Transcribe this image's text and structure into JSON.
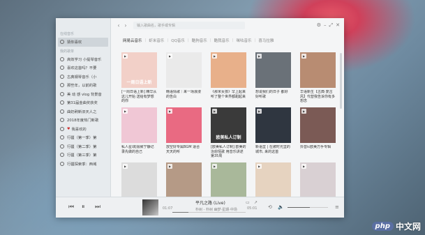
{
  "sidebar": {
    "section_online": "在线音乐",
    "active_item": "猜你喜欢",
    "section_playlists": "我的歌单",
    "items": [
      "高效学习 小提琴音乐",
      "喜欢这首吗？不要",
      "古典钢琴音乐（小",
      "那些年，以前的歌",
      "美 动 感 vlog 背景音",
      "第31届金曲奖获奖",
      "曲奶刷新旧天人之",
      "2018年度热门新歌",
      "我喜欢的",
      "行疆（第一季）第",
      "行疆（第二季）第",
      "行疆（第三季）第",
      "行疆探索季：西域"
    ]
  },
  "topbar": {
    "search_placeholder": "输入歌曲名，歌手或专辑"
  },
  "tabs": [
    "网易云音乐",
    "虾米音乐",
    "QQ音乐",
    "酷狗音乐",
    "酷我音乐",
    "咪咕音乐",
    "喜马拉雅"
  ],
  "cards": [
    {
      "caption": "[一周日语上新] 精华从这儿开始 送给有梦想的你",
      "cover_text": "一周日语上新",
      "color": "#f2d0c8"
    },
    {
      "caption": "韩语情歌｜来一场浪漫的告白",
      "cover_text": "",
      "color": "#eaeaea"
    },
    {
      "caption": "《那米女孩》早上起来听了整个世界都甜起来",
      "cover_text": "",
      "color": "#e8b08a"
    },
    {
      "caption": "想说我们的日子 都好好听歌",
      "cover_text": "",
      "color": "#6a7178"
    },
    {
      "caption": "华语新生【古典·复古风】代替我告诉你有多想念",
      "cover_text": "",
      "color": "#b88c72"
    },
    {
      "caption": "私人星球|极致宁静记录先做的自己",
      "cover_text": "",
      "color": "#f0c7d5"
    },
    {
      "caption": "放空好专属BGM 适合天天的听",
      "cover_text": "",
      "color": "#e96a82"
    },
    {
      "caption": "[欧美私人订制] 欧美的治愈情歌 用音乐讲述第35周",
      "cover_text": "欧美私人订制",
      "color": "#3a3a3a"
    },
    {
      "caption": "新语里 | 在被时光里的城市, 来的这首",
      "cover_text": "",
      "color": "#2f3640"
    },
    {
      "caption": "抖音ic欧美万手专辑",
      "cover_text": "",
      "color": "#7b5a55"
    },
    {
      "caption": "",
      "cover_text": "",
      "color": "#dcdcdc"
    },
    {
      "caption": "",
      "cover_text": "",
      "color": "#b59a86"
    },
    {
      "caption": "",
      "cover_text": "",
      "color": "#a9b89a"
    },
    {
      "caption": "",
      "cover_text": "",
      "color": "#e6d3c0"
    },
    {
      "caption": "",
      "cover_text": "",
      "color": "#d9d0d3"
    }
  ],
  "player": {
    "title": "平凡之路 (Live)",
    "artist": "朴树 - 朴树 幽梦·星期·中场",
    "time_current": "01:07",
    "time_total": "05:01",
    "progress": 0.22,
    "volume": 0.55
  },
  "watermark": {
    "logo": "php",
    "text": "中文网"
  }
}
